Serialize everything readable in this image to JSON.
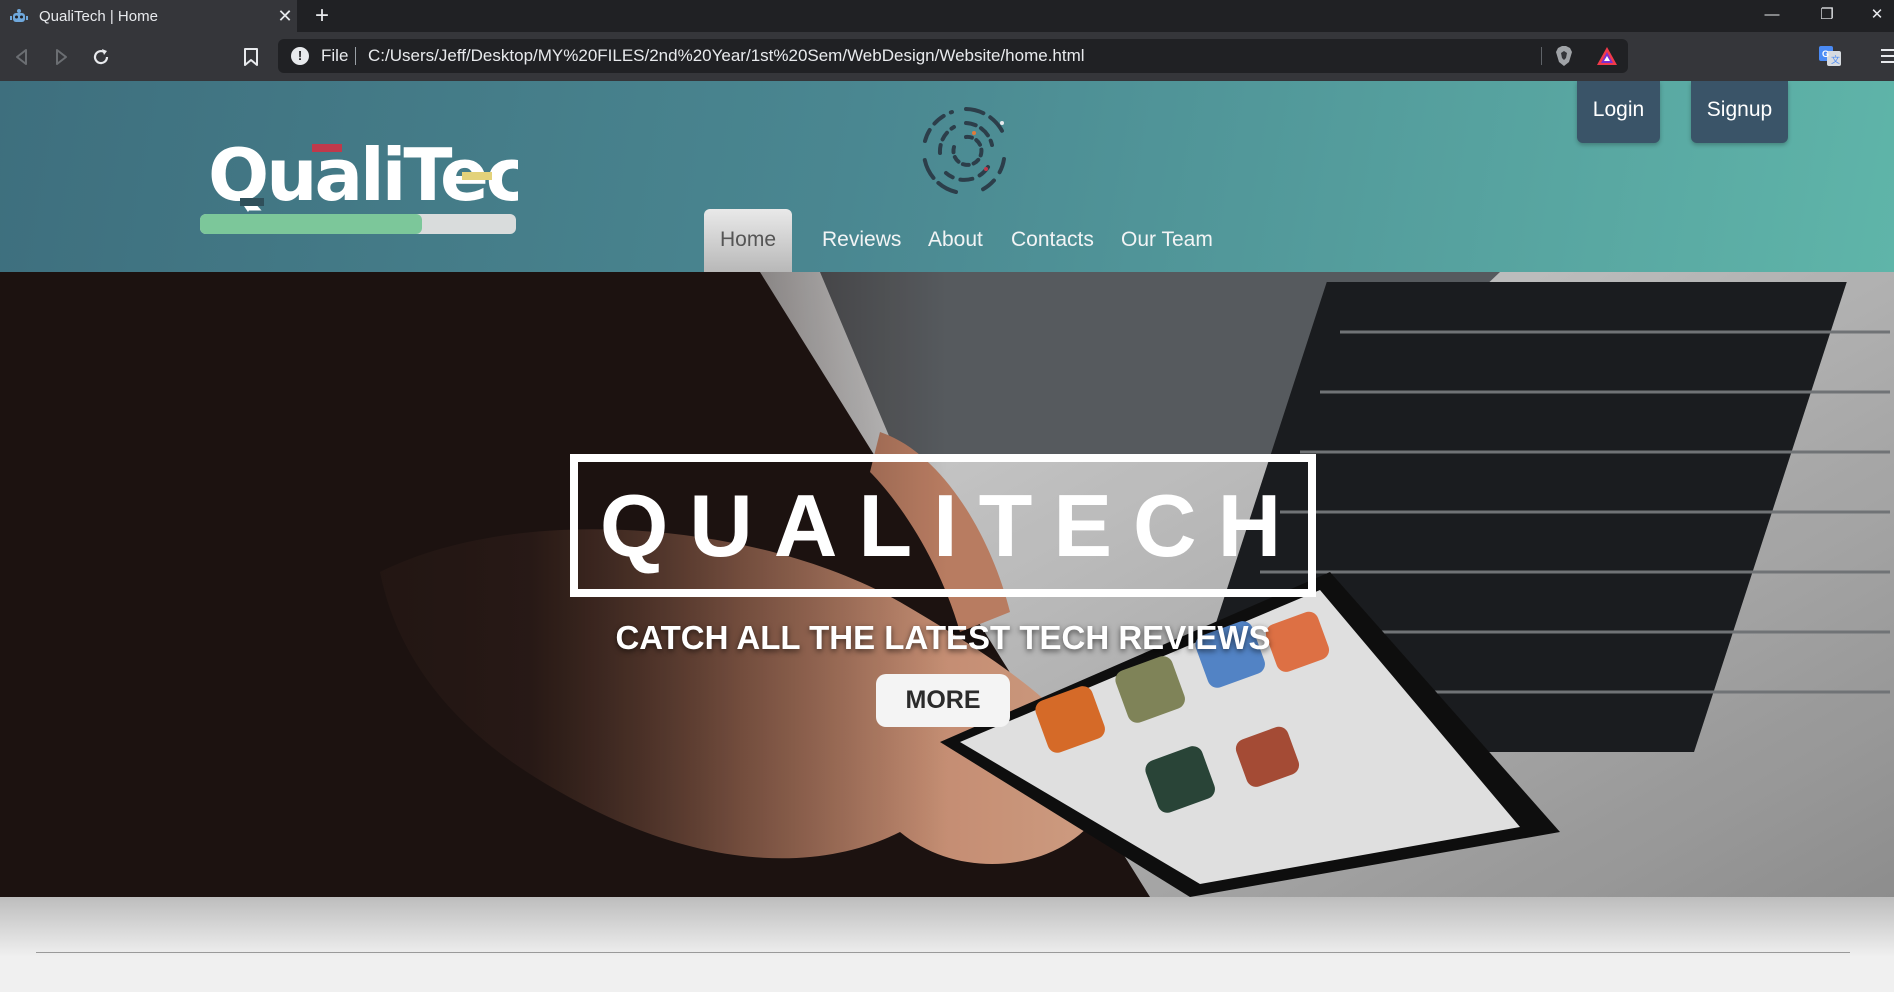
{
  "browser": {
    "tab_title": "QualiTech | Home",
    "tab_close": "✕",
    "new_tab": "+",
    "window_controls": {
      "minimize": "—",
      "restore": "❐",
      "close": "✕"
    },
    "address": {
      "scheme_label": "File",
      "info": "!",
      "url": "C:/Users/Jeff/Desktop/MY%20FILES/2nd%20Year/1st%20Sem/WebDesign/Website/home.html"
    },
    "icons": [
      "back-icon",
      "forward-icon",
      "reload-icon",
      "bookmark-icon",
      "info-icon",
      "brave-shield-icon",
      "brave-rewards-icon",
      "translate-icon",
      "menu-icon"
    ]
  },
  "site": {
    "logo_text": "QualiTech",
    "auth": {
      "login": "Login",
      "signup": "Signup"
    },
    "nav": [
      {
        "label": "Home",
        "active": true
      },
      {
        "label": "Reviews",
        "active": false
      },
      {
        "label": "About",
        "active": false
      },
      {
        "label": "Contacts",
        "active": false
      },
      {
        "label": "Our Team",
        "active": false
      }
    ],
    "hero": {
      "title": "QUALITECH",
      "subtitle": "CATCH ALL THE LATEST TECH REVIEWS",
      "cta": "MORE"
    },
    "colors": {
      "header_start": "#3e6f7e",
      "header_end": "#5fb5a9",
      "auth_button": "#3a5468",
      "logo_bar": "#7cc79a",
      "logo_accent_red": "#c0394b",
      "logo_accent_yellow": "#e3d27a"
    }
  }
}
